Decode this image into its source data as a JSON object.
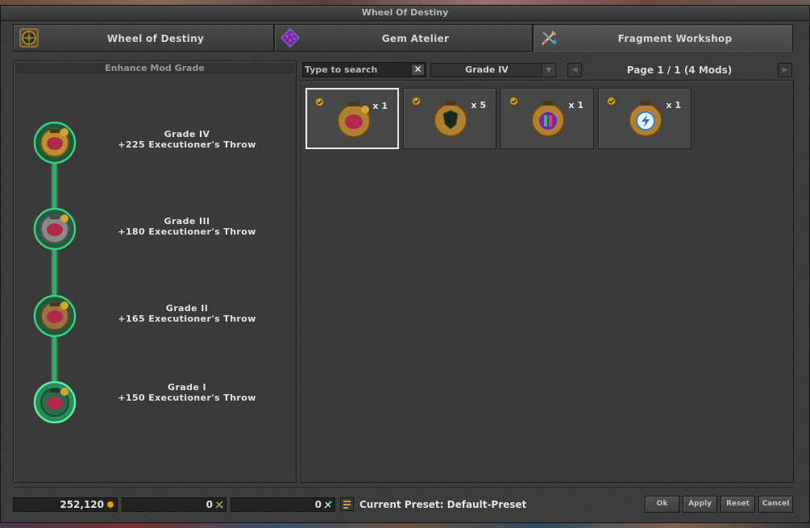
{
  "window": {
    "title": "Wheel Of Destiny"
  },
  "tabs": [
    {
      "label": "Wheel of Destiny",
      "icon": "wheel-icon"
    },
    {
      "label": "Gem Atelier",
      "icon": "gem-icon"
    },
    {
      "label": "Fragment Workshop",
      "icon": "fragment-tools-icon",
      "active": true
    }
  ],
  "left_panel": {
    "header": "Enhance Mod Grade",
    "grades": [
      {
        "name": "Grade IV",
        "bonus": "+225 Executioner's Throw"
      },
      {
        "name": "Grade III",
        "bonus": "+180 Executioner's Throw"
      },
      {
        "name": "Grade II",
        "bonus": "+165 Executioner's Throw"
      },
      {
        "name": "Grade I",
        "bonus": "+150 Executioner's Throw"
      }
    ]
  },
  "toolbar": {
    "search_placeholder": "Type to search",
    "clear_label": "✕",
    "grade_filter": "Grade IV",
    "page_info": "Page 1 / 1 (4 Mods)"
  },
  "mods": [
    {
      "quantity": "x 1",
      "icon": "red-gem-mod-icon",
      "selected": true
    },
    {
      "quantity": "x 5",
      "icon": "dark-shield-mod-icon",
      "selected": false
    },
    {
      "quantity": "x 1",
      "icon": "prismatic-mod-icon",
      "selected": false
    },
    {
      "quantity": "x 1",
      "icon": "lightning-mod-icon",
      "selected": false
    }
  ],
  "footer": {
    "gold": "252,120",
    "lesser_fragments": "0",
    "greater_fragments": "0",
    "preset": "Current Preset: Default-Preset",
    "buttons": {
      "ok": "Ok",
      "apply": "Apply",
      "reset": "Reset",
      "cancel": "Cancel"
    }
  },
  "colors": {
    "connector": "#2fb06a",
    "accent_gold": "#d6a530",
    "background": "#3b3b3b"
  }
}
